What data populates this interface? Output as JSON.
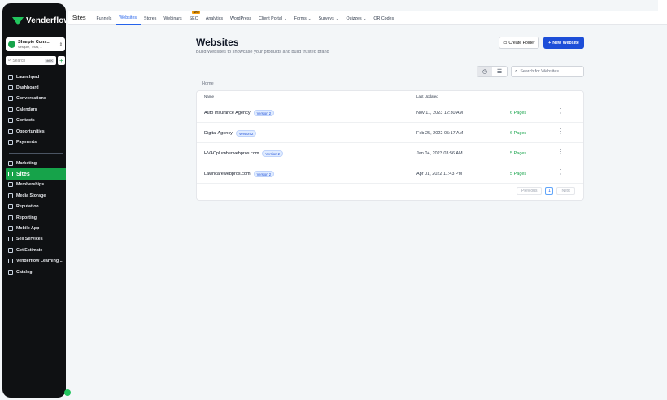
{
  "brand": {
    "name": "Venderflow",
    "accent": "#16a34a",
    "primary": "#1d4ed8"
  },
  "account": {
    "name": "Sharpie Cons...",
    "location": "Mesquite, Texas, ..."
  },
  "sidebar_search": {
    "placeholder": "Search",
    "shortcut": "ctrl K"
  },
  "sidebar": {
    "items": [
      {
        "label": "Launchpad",
        "icon": "rocket-icon"
      },
      {
        "label": "Dashboard",
        "icon": "dashboard-icon"
      },
      {
        "label": "Conversations",
        "icon": "chat-icon"
      },
      {
        "label": "Calendars",
        "icon": "calendar-icon"
      },
      {
        "label": "Contacts",
        "icon": "contacts-icon"
      },
      {
        "label": "Opportunities",
        "icon": "opportunities-icon"
      },
      {
        "label": "Payments",
        "icon": "payments-icon"
      }
    ],
    "items2": [
      {
        "label": "Marketing",
        "icon": "marketing-icon"
      },
      {
        "label": "Sites",
        "icon": "sites-icon"
      },
      {
        "label": "Memberships",
        "icon": "memberships-icon"
      },
      {
        "label": "Media Storage",
        "icon": "media-icon"
      },
      {
        "label": "Reputation",
        "icon": "reputation-icon"
      },
      {
        "label": "Reporting",
        "icon": "reporting-icon"
      },
      {
        "label": "Mobile App",
        "icon": "mobile-icon"
      },
      {
        "label": "Sell Services",
        "icon": "sell-icon"
      },
      {
        "label": "Get Estimate",
        "icon": "estimate-icon"
      },
      {
        "label": "Venderflow Learning ...",
        "icon": "learning-icon"
      },
      {
        "label": "Catalog",
        "icon": "catalog-icon"
      }
    ]
  },
  "topbar": {
    "section": "Sites",
    "tabs": [
      {
        "label": "Funnels"
      },
      {
        "label": "Websites"
      },
      {
        "label": "Stores"
      },
      {
        "label": "Webinars"
      },
      {
        "label": "SEO",
        "badge": "New"
      },
      {
        "label": "Analytics"
      },
      {
        "label": "WordPress"
      },
      {
        "label": "Client Portal",
        "dropdown": "⌄"
      },
      {
        "label": "Forms",
        "dropdown": "⌄"
      },
      {
        "label": "Surveys",
        "dropdown": "⌄"
      },
      {
        "label": "Quizzes",
        "dropdown": "⌄"
      },
      {
        "label": "QR Codes"
      }
    ]
  },
  "page": {
    "title": "Websites",
    "subtitle": "Build Websites to showcase your products and build trusted brand",
    "create_folder": "Create Folder",
    "new_website": "New Website",
    "search_placeholder": "Search for Websites",
    "breadcrumb": "Home"
  },
  "table": {
    "columns": [
      "Name",
      "Last Updated"
    ],
    "rows": [
      {
        "name": "Auto Insurance Agency",
        "version": "Version 2",
        "updated": "Nov 11, 2023 12:30 AM",
        "pages": "6 Pages"
      },
      {
        "name": "Digital Agency",
        "version": "Version 2",
        "updated": "Feb 25, 2022 05:17 AM",
        "pages": "6 Pages"
      },
      {
        "name": "HVACplumberwebpros.com",
        "version": "Version 2",
        "updated": "Jan 04, 2023 03:56 AM",
        "pages": "5 Pages"
      },
      {
        "name": "Lawncarewebpros.com",
        "version": "Version 2",
        "updated": "Apr 01, 2022 11:43 PM",
        "pages": "5 Pages"
      }
    ]
  },
  "pagination": {
    "previous": "Previous",
    "current": "1",
    "next": "Next"
  }
}
